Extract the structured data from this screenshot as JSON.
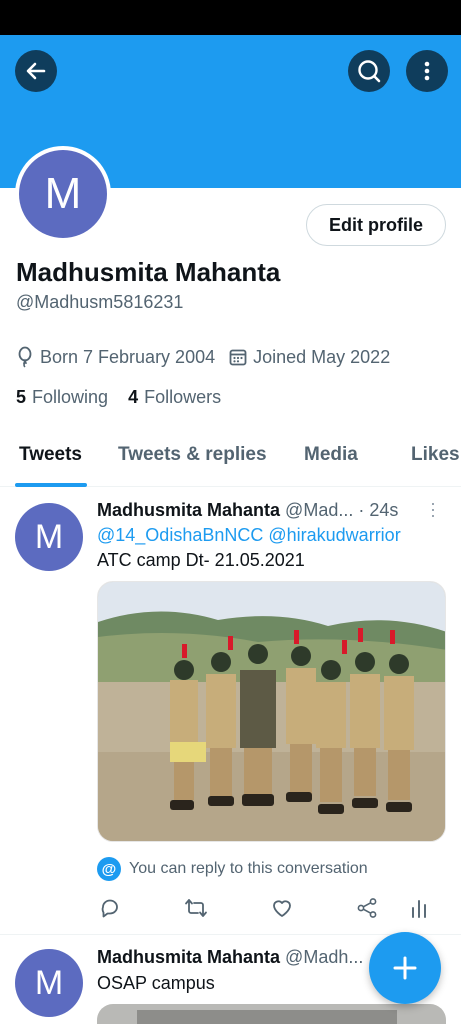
{
  "colors": {
    "accent": "#1d9bf0",
    "banner": "#1d9bf0",
    "avatar": "#5c6bc0",
    "secondary_text": "#536471"
  },
  "header": {
    "back_icon": "arrow-left-icon",
    "search_icon": "search-icon",
    "more_icon": "more-vertical-icon"
  },
  "profile": {
    "avatar_letter": "M",
    "edit_label": "Edit profile",
    "name": "Madhusmita Mahanta",
    "handle": "@Madhusm5816231",
    "born": "Born 7 February 2004",
    "joined": "Joined May 2022",
    "following_count": "5",
    "following_label": "Following",
    "followers_count": "4",
    "followers_label": "Followers"
  },
  "tabs": [
    {
      "label": "Tweets",
      "active": true
    },
    {
      "label": "Tweets & replies",
      "active": false
    },
    {
      "label": "Media",
      "active": false
    },
    {
      "label": "Likes",
      "active": false
    }
  ],
  "tweets": [
    {
      "avatar_letter": "M",
      "author": "Madhusmita Mahanta",
      "handle": "@Mad...",
      "time": "· 24s",
      "mentions": [
        "@14_OdishaBnNCC",
        "@hirakudwarrior"
      ],
      "text": "ATC camp Dt- 21.05.2021",
      "reply_note": "You can reply to this conversation",
      "reply_icon_text": "@"
    },
    {
      "avatar_letter": "M",
      "author": "Madhusmita Mahanta",
      "handle": "@Madh...",
      "text": "OSAP campus"
    }
  ],
  "fab_icon": "plus-icon"
}
